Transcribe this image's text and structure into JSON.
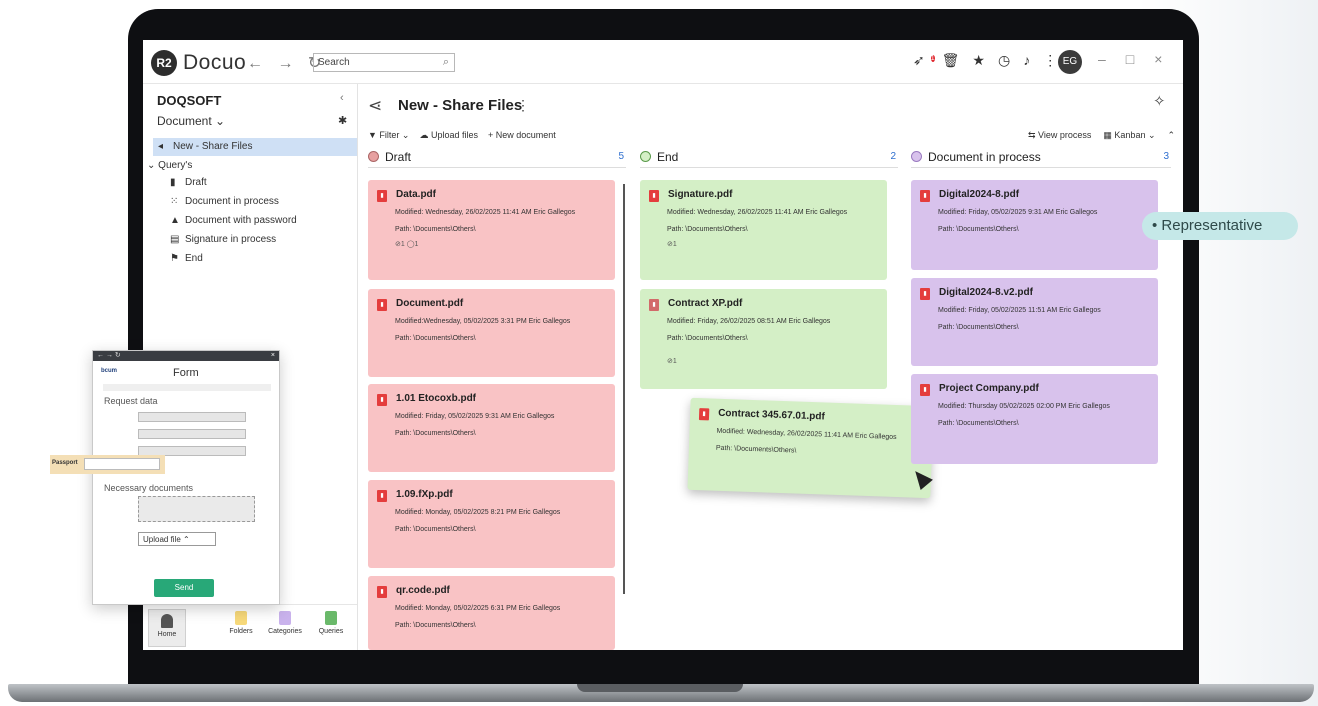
{
  "app": {
    "logo_mark": "R2",
    "logo_text": "Docuo",
    "nav_arrows": "← → ↻"
  },
  "titlebar": {
    "search_placeholder": "Search",
    "notification_count": "1",
    "avatar_initials": "EG",
    "icons": [
      "rocket-icon",
      "trash-icon",
      "star-icon",
      "clock-icon",
      "bell-icon",
      "more-vertical-icon"
    ]
  },
  "sidebar": {
    "workspace": "DOQSOFT",
    "document_selector": "Document ⌄",
    "active_item": "New - Share Files",
    "group_label": "Query's",
    "queries": [
      {
        "label": "Draft",
        "icon": "file-icon"
      },
      {
        "label": "Document in process",
        "icon": "spinner-icon"
      },
      {
        "label": "Document with password",
        "icon": "lock-icon"
      },
      {
        "label": "Signature in process",
        "icon": "signature-icon"
      },
      {
        "label": "End",
        "icon": "flag-icon"
      }
    ],
    "bottom_nav": [
      {
        "label": "Home",
        "color": "#5a5a5a"
      },
      {
        "label": "Folders",
        "color": "#f7d97a"
      },
      {
        "label": "Categories",
        "color": "#c9b2ec"
      },
      {
        "label": "Queries",
        "color": "#6ab96a"
      }
    ]
  },
  "main": {
    "title": "New - Share Files",
    "toolbar": {
      "filter": "Filter ⌄",
      "upload": "Upload files",
      "new_document": "New document"
    },
    "toolbar_right": {
      "view_process": "View process",
      "kanban": "Kanban ⌄"
    },
    "columns": [
      {
        "name": "Draft",
        "count": "5",
        "dot_color": "#e7a0a0"
      },
      {
        "name": "End",
        "count": "2",
        "dot_color": "#9ccf8a"
      },
      {
        "name": "Document in process",
        "count": "3",
        "dot_color": "#c9b2ec"
      }
    ],
    "draft_cards": [
      {
        "name": "Data.pdf",
        "modified": "Modified: Wednesday, 26/02/2025 11:41 AM Eric Gallegos",
        "path": "Path: \\Documents\\Others\\",
        "meta": "⊘1 ◯1"
      },
      {
        "name": "Document.pdf",
        "modified": "Modified:Wednesday, 05/02/2025 3:31 PM Eric Gallegos",
        "path": "Path: \\Documents\\Others\\"
      },
      {
        "name": "1.01 Etocoxb.pdf",
        "modified": "Modified: Friday, 05/02/2025 9:31 AM Eric Gallegos",
        "path": "Path: \\Documents\\Others\\"
      },
      {
        "name": "1.09.fXp.pdf",
        "modified": "Modified: Monday, 05/02/2025 8:21 PM Eric Gallegos",
        "path": "Path: \\Documents\\Others\\"
      },
      {
        "name": "qr.code.pdf",
        "modified": "Modified: Monday, 05/02/2025 6:31 PM Eric Gallegos",
        "path": "Path: \\Documents\\Others\\"
      }
    ],
    "end_cards": [
      {
        "name": "Signature.pdf",
        "modified": "Modified: Wednesday, 26/02/2025 11:41 AM Eric Gallegos",
        "path": "Path: \\Documents\\Others\\",
        "meta": "⊘1"
      },
      {
        "name": "Contract XP.pdf",
        "modified": "Modified: Friday, 26/02/2025 08:51 AM Eric Gallegos",
        "path": "Path: \\Documents\\Others\\",
        "meta": "⊘1"
      }
    ],
    "dragged_card": {
      "name": "Contract 345.67.01.pdf",
      "modified": "Modified: Wednesday, 26/02/2025 11:41 AM Eric Gallegos",
      "path": "Path: \\Documents\\Others\\"
    },
    "process_cards": [
      {
        "name": "Digital2024-8.pdf",
        "modified": "Modified: Friday, 05/02/2025 9:31 AM Eric Gallegos",
        "path": "Path: \\Documents\\Others\\"
      },
      {
        "name": "Digital2024-8.v2.pdf",
        "modified": "Modified: Friday, 05/02/2025 11:51 AM Eric Gallegos",
        "path": "Path: \\Documents\\Others\\"
      },
      {
        "name": "Project Company.pdf",
        "modified": "Modified: Thursday 05/02/2025 02:00 PM Eric Gallegos",
        "path": "Path: \\Documents\\Others\\"
      }
    ]
  },
  "pill": {
    "label": "• Representative"
  },
  "form": {
    "window_controls": "← → ↻",
    "close": "×",
    "logo": "bcum",
    "title": "Form",
    "section_request": "Request data",
    "passport_label": "Passport",
    "section_documents": "Necessary documents",
    "upload_button": "Upload file",
    "send_button": "Send"
  }
}
